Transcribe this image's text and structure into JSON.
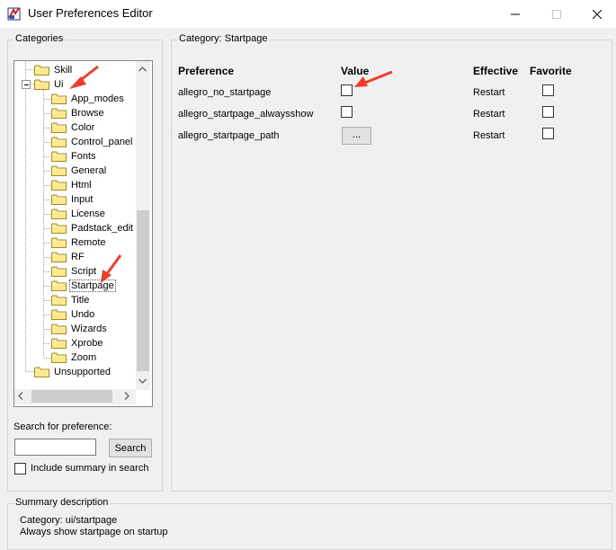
{
  "window": {
    "title": "User Preferences Editor"
  },
  "categories": {
    "group_label": "Categories",
    "tree": [
      {
        "label": "Skill",
        "level": 1
      },
      {
        "label": "Ui",
        "level": 1
      },
      {
        "label": "App_modes",
        "level": 2
      },
      {
        "label": "Browse",
        "level": 2
      },
      {
        "label": "Color",
        "level": 2
      },
      {
        "label": "Control_panel",
        "level": 2
      },
      {
        "label": "Fonts",
        "level": 2
      },
      {
        "label": "General",
        "level": 2
      },
      {
        "label": "Html",
        "level": 2
      },
      {
        "label": "Input",
        "level": 2
      },
      {
        "label": "License",
        "level": 2
      },
      {
        "label": "Padstack_edit",
        "level": 2
      },
      {
        "label": "Remote",
        "level": 2
      },
      {
        "label": "RF",
        "level": 2
      },
      {
        "label": "Script",
        "level": 2
      },
      {
        "label": "Startpage",
        "level": 2,
        "selected": true
      },
      {
        "label": "Title",
        "level": 2
      },
      {
        "label": "Undo",
        "level": 2
      },
      {
        "label": "Wizards",
        "level": 2
      },
      {
        "label": "Xprobe",
        "level": 2
      },
      {
        "label": "Zoom",
        "level": 2
      },
      {
        "label": "Unsupported",
        "level": 1
      }
    ],
    "search_label": "Search for preference:",
    "search_value": "",
    "search_button": "Search",
    "include_summary_label": "Include summary in search",
    "include_summary_checked": false
  },
  "preferences": {
    "group_label": "Category:  Startpage",
    "headers": {
      "preference": "Preference",
      "value": "Value",
      "effective": "Effective",
      "favorite": "Favorite"
    },
    "rows": [
      {
        "name": "allegro_no_startpage",
        "value_type": "checkbox",
        "effective": "Restart"
      },
      {
        "name": "allegro_startpage_alwaysshow",
        "value_type": "checkbox",
        "effective": "Restart"
      },
      {
        "name": "allegro_startpage_path",
        "value_type": "button",
        "button_label": "...",
        "effective": "Restart"
      }
    ]
  },
  "summary": {
    "group_label": "Summary description",
    "category_line": "Category: ui/startpage",
    "description_line": "Always show startpage on startup"
  },
  "colors": {
    "folder_fill": "#ffe98a",
    "folder_stroke": "#a08a2a",
    "annotation_arrow": "#f03c2c"
  },
  "icons": [
    "app-icon",
    "minimize-icon",
    "maximize-icon",
    "close-icon",
    "folder-icon",
    "collapse-icon",
    "scroll-up-arrow-icon",
    "scroll-down-arrow-icon",
    "scroll-left-arrow-icon",
    "scroll-right-arrow-icon"
  ]
}
